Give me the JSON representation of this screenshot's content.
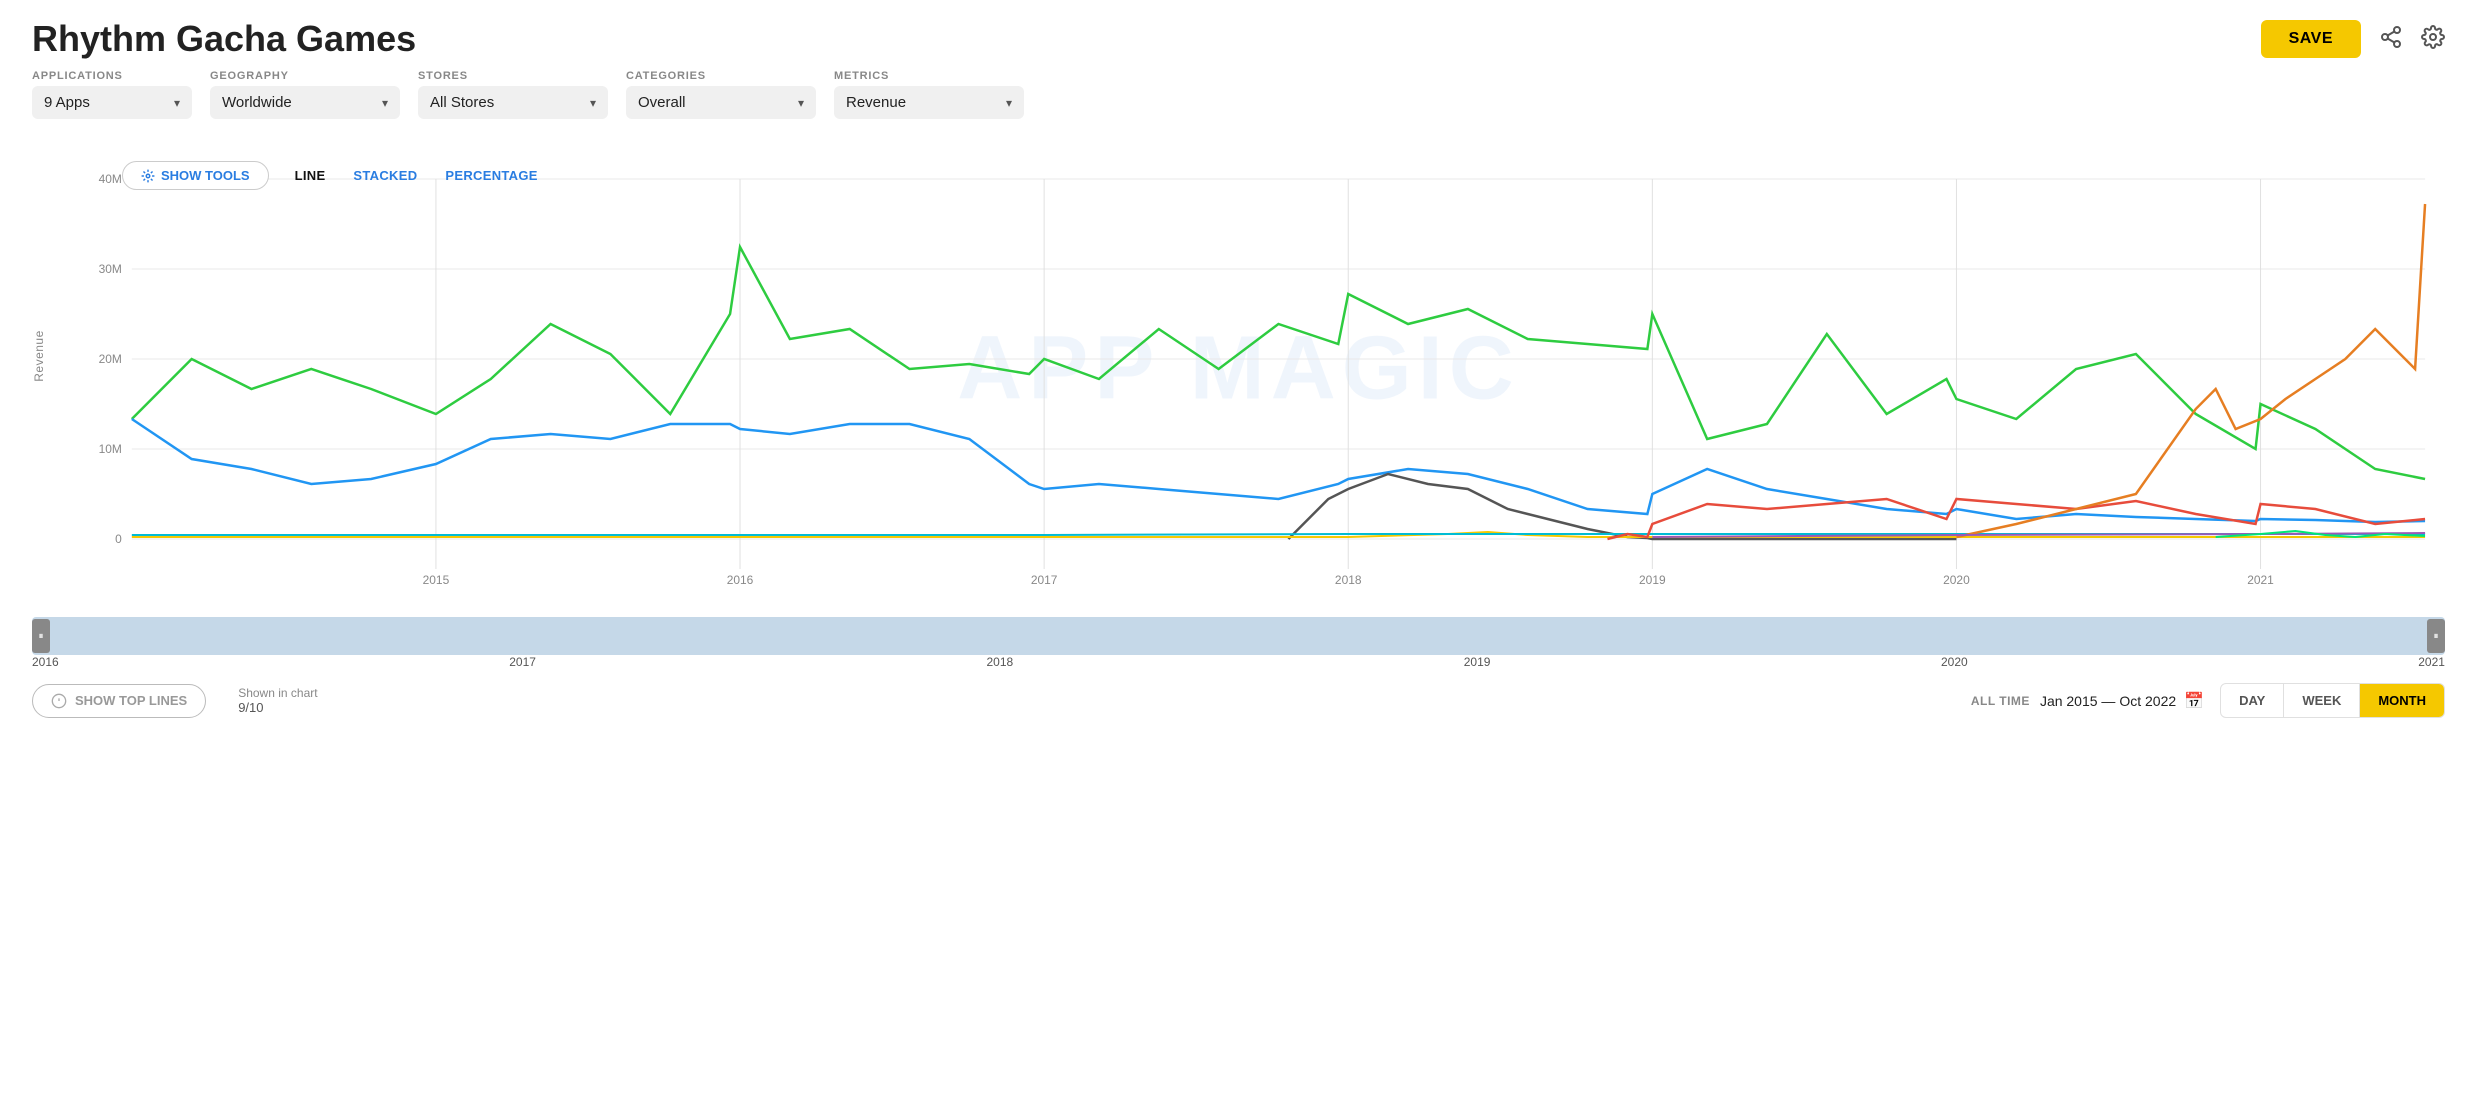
{
  "title": "Rhythm Gacha Games",
  "header": {
    "save_label": "SAVE",
    "share_icon": "⋯",
    "settings_icon": "⚙"
  },
  "filters": {
    "applications": {
      "label": "APPLICATIONS",
      "value": "9 Apps",
      "options": [
        "9 Apps"
      ]
    },
    "geography": {
      "label": "GEOGRAPHY",
      "value": "Worldwide",
      "options": [
        "Worldwide"
      ]
    },
    "stores": {
      "label": "STORES",
      "value": "All Stores",
      "options": [
        "All Stores"
      ]
    },
    "categories": {
      "label": "CATEGORIES",
      "value": "Overall",
      "options": [
        "Overall"
      ]
    },
    "metrics": {
      "label": "METRICS",
      "value": "Revenue",
      "options": [
        "Revenue"
      ]
    }
  },
  "chart": {
    "show_tools_label": "SHOW TOOLS",
    "chart_types": [
      "LINE",
      "STACKED",
      "PERCENTAGE"
    ],
    "active_type": "LINE",
    "y_axis_label": "Revenue",
    "y_labels": [
      "40M",
      "30M",
      "20M",
      "10M",
      "0"
    ],
    "x_labels": [
      "2015",
      "2016",
      "2017",
      "2018",
      "2019",
      "2020",
      "2021"
    ],
    "watermark": "APP MAGIC"
  },
  "timeline": {
    "labels": [
      "2016",
      "2017",
      "2018",
      "2019",
      "2020",
      "2021"
    ],
    "left_handle": "⏸",
    "right_handle": "⏸"
  },
  "bottom": {
    "show_top_lines_label": "SHOW TOP LINES",
    "shown_label": "Shown in chart",
    "shown_value": "9/10",
    "all_time_label": "ALL TIME",
    "date_range": "Jan 2015 — Oct 2022",
    "period_buttons": [
      "DAY",
      "WEEK",
      "MONTH"
    ],
    "active_period": "MONTH"
  }
}
